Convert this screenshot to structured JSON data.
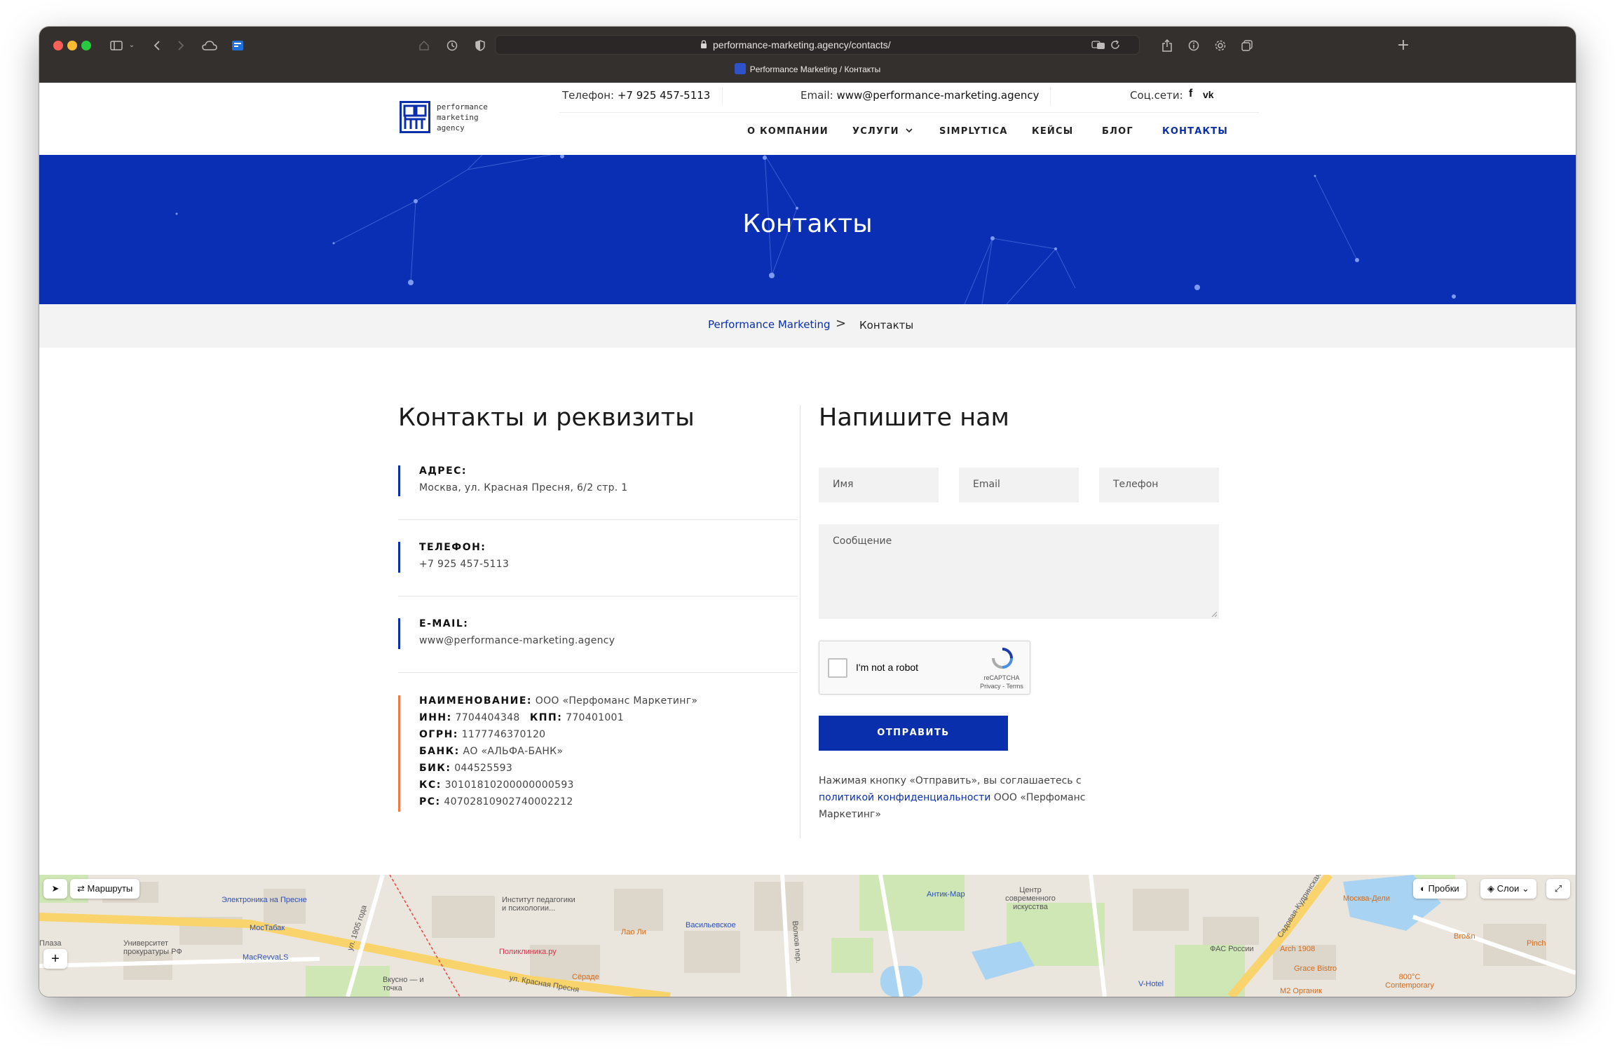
{
  "browser": {
    "url": "performance-marketing.agency/contacts/",
    "tab_title": "Performance Marketing / Контакты"
  },
  "header": {
    "logo_lines": [
      "performance",
      "marketing",
      "agency"
    ],
    "phone_label": "Телефон:",
    "phone_value": "+7 925 457-5113",
    "email_label": "Email:",
    "email_value": "www@performance-marketing.agency",
    "social_label": "Соц.сети:",
    "social_icons": [
      "facebook-icon",
      "vk-icon"
    ],
    "nav": [
      {
        "label": "О КОМПАНИИ",
        "active": false
      },
      {
        "label": "УСЛУГИ",
        "active": false,
        "has_dropdown": true
      },
      {
        "label": "SIMPLYTICA",
        "active": false
      },
      {
        "label": "КЕЙСЫ",
        "active": false
      },
      {
        "label": "БЛОГ",
        "active": false
      },
      {
        "label": "КОНТАКТЫ",
        "active": true
      }
    ]
  },
  "hero": {
    "title": "Контакты"
  },
  "breadcrumb": {
    "home": "Performance Marketing",
    "separator": ">",
    "current": "Контакты"
  },
  "contacts": {
    "title": "Контакты и реквизиты",
    "address_label": "АДРЕС:",
    "address_value": "Москва, ул. Красная Пресня, 6/2 стр. 1",
    "phone_label": "ТЕЛЕФОН:",
    "phone_value": "+7 925 457-5113",
    "email_label": "E-MAIL:",
    "email_value": "www@performance-marketing.agency",
    "requisites": [
      {
        "key": "НАИМЕНОВАНИЕ:",
        "value": "ООО «Перфоманс Маркетинг»"
      },
      {
        "key": "ИНН:",
        "value": "7704404348",
        "key2": "КПП:",
        "value2": "770401001"
      },
      {
        "key": "ОГРН:",
        "value": "1177746370120"
      },
      {
        "key": "БАНК:",
        "value": "АО «АЛЬФА-БАНК»"
      },
      {
        "key": "БИК:",
        "value": "044525593"
      },
      {
        "key": "КС:",
        "value": "30101810200000000593"
      },
      {
        "key": "РС:",
        "value": "40702810902740002212"
      }
    ]
  },
  "form": {
    "title": "Напишите нам",
    "name_placeholder": "Имя",
    "email_placeholder": "Email",
    "phone_placeholder": "Телефон",
    "message_placeholder": "Сообщение",
    "captcha_text": "I'm not a robot",
    "captcha_brand": "reCAPTCHA",
    "captcha_links": "Privacy - Terms",
    "submit_label": "ОТПРАВИТЬ",
    "policy_prefix": "Нажимая кнопку «Отправить», вы соглашаетесь с ",
    "policy_link": "политикой конфиденциальности",
    "policy_suffix": " ООО «Перфоманс Маркетинг»"
  },
  "map": {
    "routes_label": "Маршруты",
    "traffic_label": "Пробки",
    "layers_label": "Слои",
    "places": [
      {
        "name": "Электроника на Пресне",
        "color": "blue"
      },
      {
        "name": "МосТабак",
        "color": "blue"
      },
      {
        "name": "Университет прокуратуры РФ",
        "color": "gray"
      },
      {
        "name": "MacRevvaLS",
        "color": "blue"
      },
      {
        "name": "Институт педагогики и психологии...",
        "color": "gray"
      },
      {
        "name": "Лао Ли",
        "color": "orange"
      },
      {
        "name": "Васильевское",
        "color": "blue"
      },
      {
        "name": "Поликлиника.ру",
        "color": "red"
      },
      {
        "name": "Сёраде",
        "color": "orange"
      },
      {
        "name": "Вкусно — и точка",
        "color": "gray"
      },
      {
        "name": "ул. Красная Пресня",
        "color": "gray"
      },
      {
        "name": "ул. 1905 года",
        "color": "gray"
      },
      {
        "name": "Волков пер.",
        "color": "gray"
      },
      {
        "name": "Антик-Мар",
        "color": "blue"
      },
      {
        "name": "Центр современного искусства",
        "color": "gray"
      },
      {
        "name": "V-Hotel",
        "color": "blue"
      },
      {
        "name": "ФАС России",
        "color": "gray"
      },
      {
        "name": "Москва-Дели",
        "color": "orange"
      },
      {
        "name": "Arch 1908",
        "color": "orange"
      },
      {
        "name": "Grace Bistro",
        "color": "orange"
      },
      {
        "name": "Bro&n",
        "color": "orange"
      },
      {
        "name": "Pinch",
        "color": "orange"
      },
      {
        "name": "800°C Contemporary",
        "color": "orange"
      },
      {
        "name": "M2 Органик",
        "color": "orange"
      },
      {
        "name": "Садовая-Кудринская ул.",
        "color": "gray"
      },
      {
        "name": "Плаза",
        "color": "gray"
      }
    ]
  }
}
